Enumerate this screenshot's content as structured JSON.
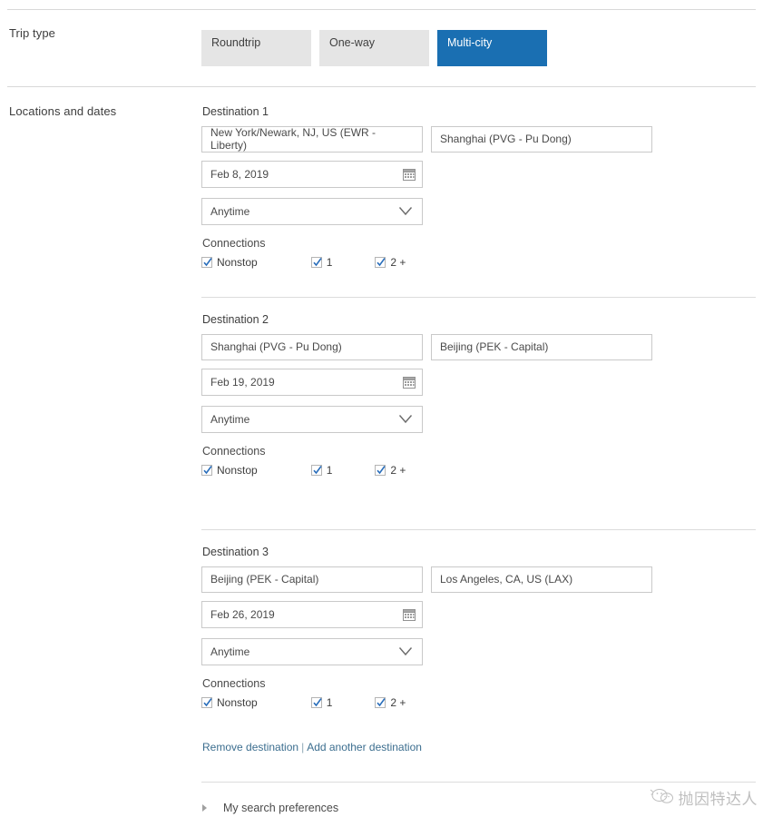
{
  "sections": {
    "trip_type_label": "Trip type",
    "locations_label": "Locations and dates"
  },
  "trip_type": {
    "options": [
      {
        "label": "Roundtrip",
        "selected": false
      },
      {
        "label": "One-way",
        "selected": false
      },
      {
        "label": "Multi-city",
        "selected": true
      }
    ],
    "selected": "Multi-city",
    "active_color": "#1a6fb2",
    "inactive_color": "#e5e5e5"
  },
  "connections_label": "Connections",
  "connection_options": [
    {
      "label": "Nonstop",
      "checked": true
    },
    {
      "label": "1",
      "checked": true
    },
    {
      "label": "2 +",
      "checked": true
    }
  ],
  "destinations": [
    {
      "title": "Destination 1",
      "origin": "New York/Newark, NJ, US (EWR - Liberty)",
      "destination": "Shanghai (PVG - Pu Dong)",
      "date": "Feb 8, 2019",
      "time": "Anytime",
      "connections_label": "Connections",
      "connections": [
        {
          "label": "Nonstop",
          "checked": true
        },
        {
          "label": "1",
          "checked": true
        },
        {
          "label": "2 +",
          "checked": true
        }
      ]
    },
    {
      "title": "Destination 2",
      "origin": "Shanghai (PVG - Pu Dong)",
      "destination": "Beijing (PEK - Capital)",
      "date": "Feb 19, 2019",
      "time": "Anytime",
      "connections_label": "Connections",
      "connections": [
        {
          "label": "Nonstop",
          "checked": true
        },
        {
          "label": "1",
          "checked": true
        },
        {
          "label": "2 +",
          "checked": true
        }
      ]
    },
    {
      "title": "Destination 3",
      "origin": "Beijing (PEK - Capital)",
      "destination": "Los Angeles, CA, US (LAX)",
      "date": "Feb 26, 2019",
      "time": "Anytime",
      "connections_label": "Connections",
      "connections": [
        {
          "label": "Nonstop",
          "checked": true
        },
        {
          "label": "1",
          "checked": true
        },
        {
          "label": "2 +",
          "checked": true
        }
      ]
    }
  ],
  "destination_links": {
    "remove": "Remove destination",
    "separator": "|",
    "add": "Add another destination",
    "color": "#3c6e8f"
  },
  "search_preferences": {
    "label": "My search preferences",
    "expanded": false
  },
  "watermark": {
    "text": "抛因特达人",
    "logo": "wechat-icon"
  }
}
